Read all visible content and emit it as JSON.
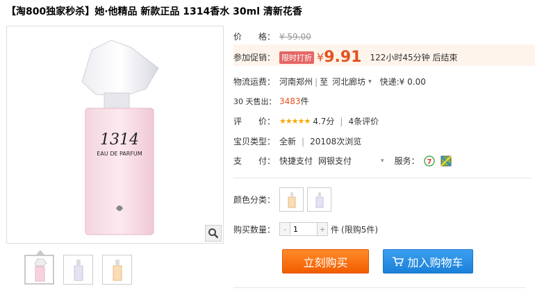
{
  "title": "【淘800独家秒杀】她·他精品 新款正品 1314香水 30ml 清新花香",
  "price": {
    "label": "价　　格：",
    "original": "¥ 59.00"
  },
  "promo": {
    "label": "参加促销：",
    "tag": "限时打折",
    "currency": "¥",
    "price": "9.91",
    "countdown": "122小时45分钟 后结束"
  },
  "shipping": {
    "label": "物流运费：",
    "from": "河南郑州",
    "divider": "|",
    "to_prefix": "至",
    "to": "河北廊坊",
    "fee_label": "快递:",
    "fee": "¥ 0.00"
  },
  "sales": {
    "label": "30 天售出：",
    "count": "3483",
    "unit": "件"
  },
  "rating": {
    "label": "评　　价：",
    "stars": "★★★★★",
    "score": "4.7分",
    "divider": "|",
    "reviews": "4条评价"
  },
  "product_type": {
    "label": "宝贝类型：",
    "condition": "全新",
    "divider": "|",
    "views": "20108次浏览"
  },
  "payment": {
    "label": "支　　付：",
    "methods": [
      "快捷支付",
      "网银支付"
    ],
    "service_label": "服务："
  },
  "color": {
    "label": "颜色分类："
  },
  "quantity": {
    "label": "购买数量：",
    "value": "1",
    "minus": "-",
    "plus": "+",
    "unit": "件",
    "limit": "(限购5件)"
  },
  "actions": {
    "buy": "立刻购买",
    "cart": "加入购物车"
  },
  "bottle": {
    "brand": "1314",
    "sub": "EAU DE PARFUM"
  },
  "colors": {
    "accent": "#e5511d",
    "buy_button": "#ff6d0b",
    "cart_button": "#1b80d8",
    "star": "#f9a800"
  },
  "icons": [
    "zoom-icon",
    "cart-icon",
    "service-7day-icon",
    "service-guarantee-icon",
    "dropdown-arrow-icon"
  ]
}
